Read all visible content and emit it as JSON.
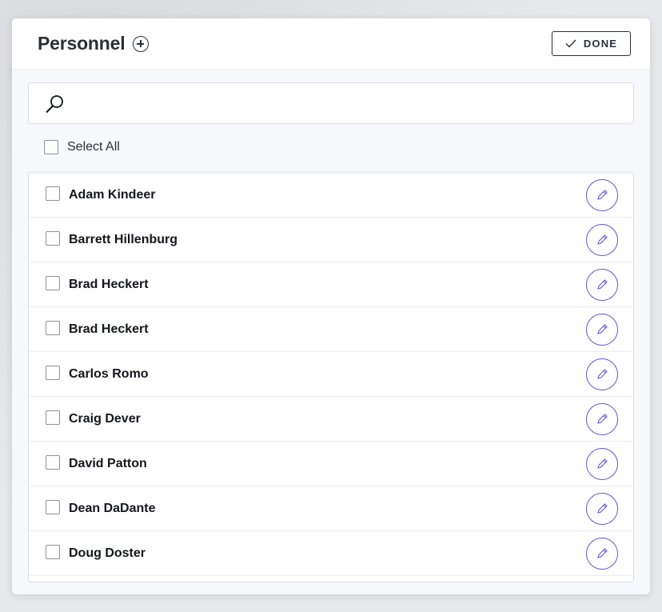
{
  "modal": {
    "title": "Personnel",
    "done_label": "DONE",
    "search": {
      "value": "",
      "placeholder": ""
    },
    "select_all_label": "Select All",
    "accent_color": "#6a52d8"
  },
  "personnel": [
    {
      "name": "Adam Kindeer"
    },
    {
      "name": "Barrett Hillenburg"
    },
    {
      "name": "Brad Heckert"
    },
    {
      "name": "Brad Heckert"
    },
    {
      "name": "Carlos Romo"
    },
    {
      "name": "Craig Dever"
    },
    {
      "name": "David Patton"
    },
    {
      "name": "Dean DaDante"
    },
    {
      "name": "Doug Doster"
    }
  ]
}
